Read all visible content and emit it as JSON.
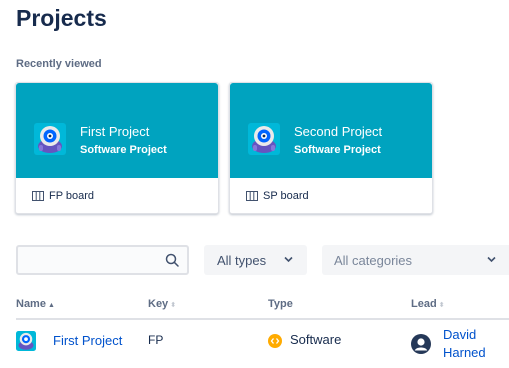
{
  "page": {
    "title": "Projects"
  },
  "recent": {
    "label": "Recently viewed",
    "cards": [
      {
        "name": "First Project",
        "type": "Software Project",
        "board": "FP board"
      },
      {
        "name": "Second Project",
        "type": "Software Project",
        "board": "SP board"
      }
    ]
  },
  "filters": {
    "search": {
      "value": "",
      "placeholder": ""
    },
    "types": "All types",
    "categories": "All categories"
  },
  "table": {
    "columns": {
      "name": "Name",
      "key": "Key",
      "type": "Type",
      "lead": "Lead"
    },
    "rows": [
      {
        "name": "First Project",
        "key": "FP",
        "type": "Software",
        "lead": "David Harned"
      }
    ]
  },
  "colors": {
    "card_header": "#00a3bf",
    "link": "#0052cc",
    "software_badge": "#ffab00",
    "text": "#172b4d"
  },
  "icons": {
    "project_avatar": "robot-avatar-icon",
    "board": "board-icon",
    "search": "search-icon",
    "software": "software-icon",
    "lead": "user-avatar-icon"
  }
}
